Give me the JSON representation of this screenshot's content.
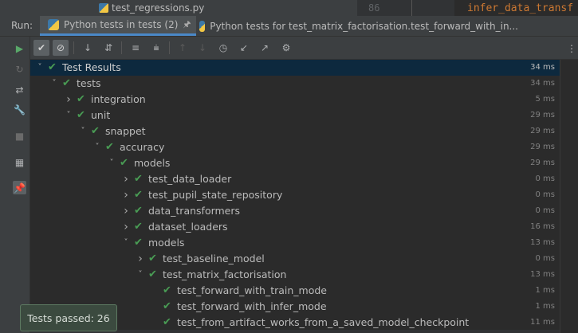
{
  "editor": {
    "file_tab": "test_regressions.py",
    "line_number": "86",
    "code_fragment": "infer_data_transf"
  },
  "run_panel": {
    "label": "Run:",
    "tabs": [
      {
        "label": "Python tests in tests (2)",
        "active": true
      },
      {
        "label": "Python tests for test_matrix_factorisation.test_forward_with_in...",
        "active": false
      }
    ]
  },
  "toolbar_icons": [
    "show-passed-icon",
    "show-ignored-icon",
    "sort-alpha-icon",
    "sort-duration-icon",
    "expand-all-icon",
    "collapse-all-icon",
    "prev-failed-icon",
    "next-failed-icon",
    "history-icon",
    "import-tests-icon",
    "export-tests-icon",
    "settings-icon"
  ],
  "side_icons": [
    "run-icon",
    "rerun-failed-icon",
    "toggle-auto-test-icon",
    "wrench-icon",
    "stop-icon",
    "layout-icon",
    "pin-icon"
  ],
  "tree": [
    {
      "label": "Test Results",
      "time": "34 ms",
      "depth": 0,
      "expanded": true,
      "selected": true
    },
    {
      "label": "tests",
      "time": "34 ms",
      "depth": 1,
      "expanded": true
    },
    {
      "label": "integration",
      "time": "5 ms",
      "depth": 2,
      "expanded": false
    },
    {
      "label": "unit",
      "time": "29 ms",
      "depth": 2,
      "expanded": true
    },
    {
      "label": "snappet",
      "time": "29 ms",
      "depth": 3,
      "expanded": true
    },
    {
      "label": "accuracy",
      "time": "29 ms",
      "depth": 4,
      "expanded": true
    },
    {
      "label": "models",
      "time": "29 ms",
      "depth": 5,
      "expanded": true
    },
    {
      "label": "test_data_loader",
      "time": "0 ms",
      "depth": 6,
      "expanded": false
    },
    {
      "label": "test_pupil_state_repository",
      "time": "0 ms",
      "depth": 6,
      "expanded": false
    },
    {
      "label": "data_transformers",
      "time": "0 ms",
      "depth": 6,
      "expanded": false
    },
    {
      "label": "dataset_loaders",
      "time": "16 ms",
      "depth": 6,
      "expanded": false
    },
    {
      "label": "models",
      "time": "13 ms",
      "depth": 6,
      "expanded": true
    },
    {
      "label": "test_baseline_model",
      "time": "0 ms",
      "depth": 7,
      "expanded": false
    },
    {
      "label": "test_matrix_factorisation",
      "time": "13 ms",
      "depth": 7,
      "expanded": true
    },
    {
      "label": "test_forward_with_train_mode",
      "time": "1 ms",
      "depth": 8,
      "leaf": true
    },
    {
      "label": "test_forward_with_infer_mode",
      "time": "1 ms",
      "depth": 8,
      "leaf": true
    },
    {
      "label": "test_from_artifact_works_from_a_saved_model_checkpoint",
      "time": "11 ms",
      "depth": 8,
      "leaf": true
    }
  ],
  "toast": {
    "text": "Tests passed: 26"
  },
  "colors": {
    "pass": "#499c54",
    "selection": "#0d293e",
    "accent": "#4a88c7"
  }
}
